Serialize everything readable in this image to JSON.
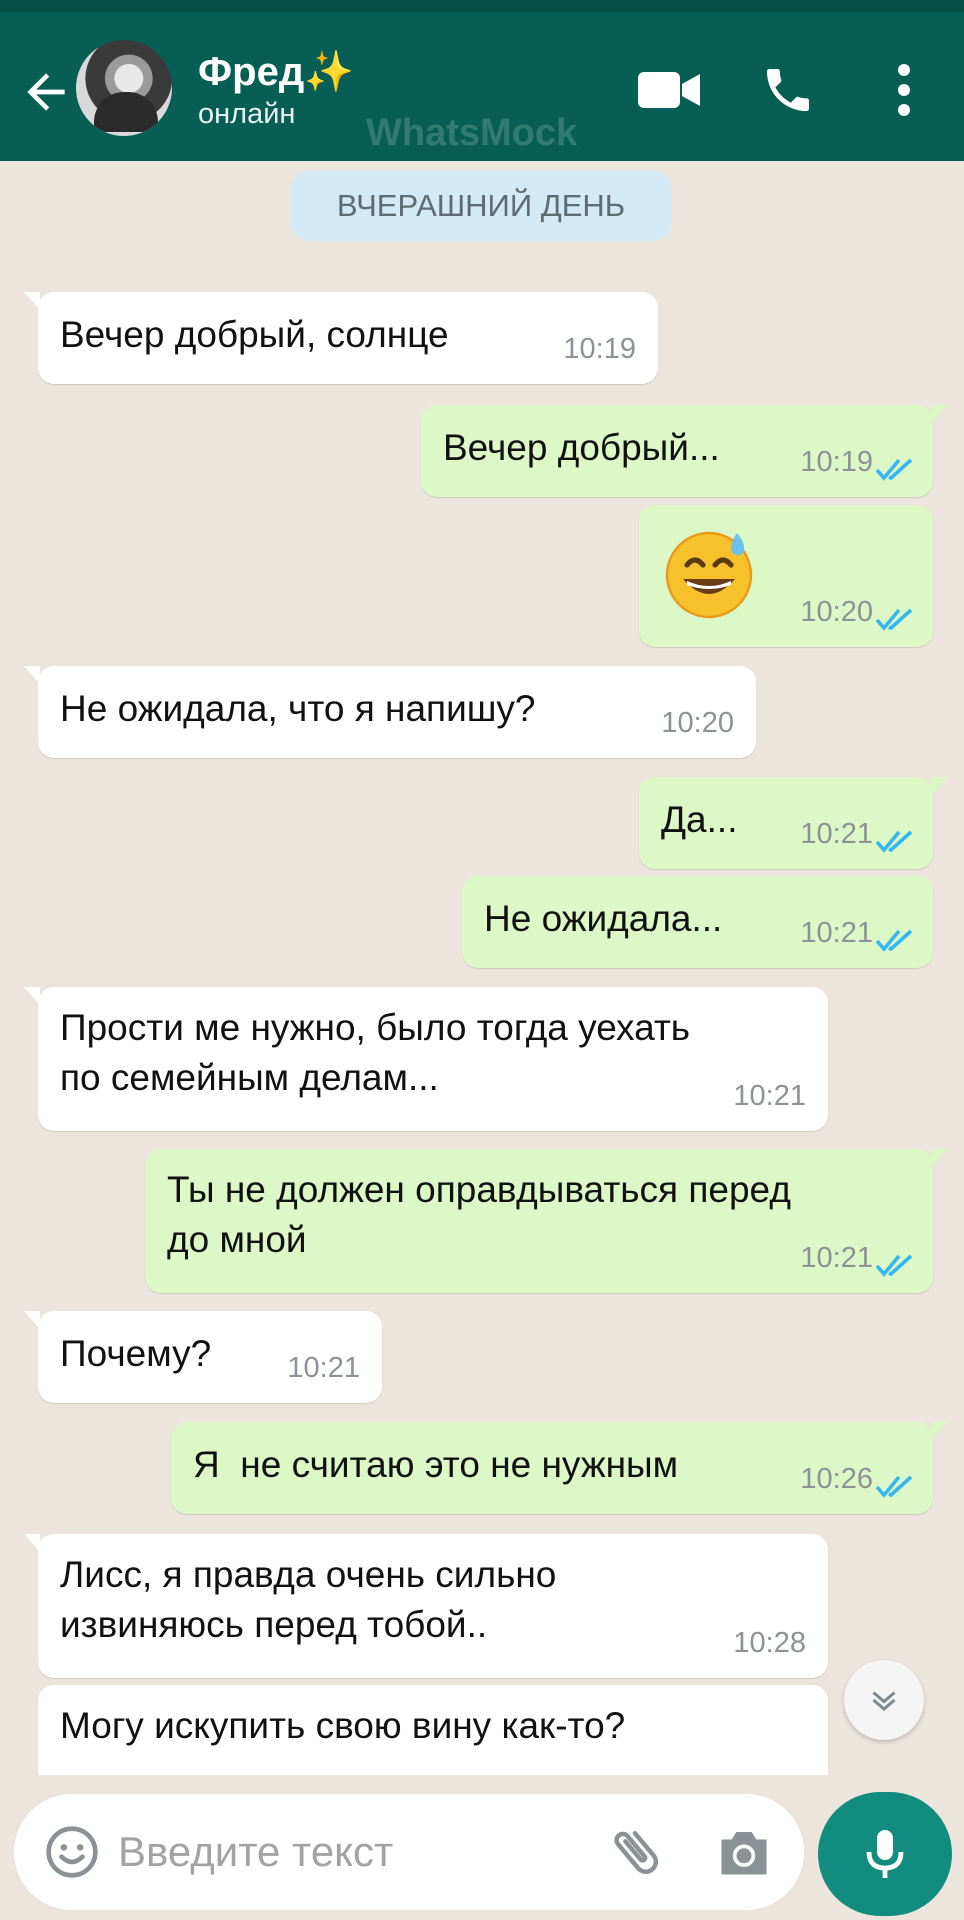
{
  "colors": {
    "header": "#075e54",
    "incoming_bubble": "#ffffff",
    "outgoing_bubble": "#dcf8c6",
    "read_ticks": "#34b7f1",
    "mic_button": "#128c7e",
    "background": "#ece5dd"
  },
  "header": {
    "contact_name": "Фред✨",
    "status": "онлайн",
    "watermark": "WhatsMock",
    "icons": [
      "back-arrow-icon",
      "video-call-icon",
      "phone-call-icon",
      "more-vert-icon"
    ]
  },
  "chat": {
    "date_chip": "ВЧЕРАШНИЙ ДЕНЬ",
    "messages": [
      {
        "direction": "in",
        "text": "Вечер добрый, солнце",
        "time": "10:19"
      },
      {
        "direction": "out",
        "text": "Вечер добрый...",
        "time": "10:19",
        "status": "read"
      },
      {
        "direction": "out",
        "emoji": "smiling-face-with-sweat-icon",
        "time": "10:20",
        "status": "read"
      },
      {
        "direction": "in",
        "text": "Не ожидала, что я напишу?",
        "time": "10:20"
      },
      {
        "direction": "out",
        "text": "Да...",
        "time": "10:21",
        "status": "read"
      },
      {
        "direction": "out",
        "text": "Не ожидала...",
        "time": "10:21",
        "status": "read"
      },
      {
        "direction": "in",
        "lines": [
          "Прости ме нужно, было тогда уехать",
          "по семейным делам..."
        ],
        "time": "10:21"
      },
      {
        "direction": "out",
        "lines": [
          "Ты не должен оправдываться перед",
          "до мной"
        ],
        "time": "10:21",
        "status": "read"
      },
      {
        "direction": "in",
        "text": "Почему?",
        "time": "10:21"
      },
      {
        "direction": "out",
        "text": "Я  не считаю это не нужным",
        "time": "10:26",
        "status": "read"
      },
      {
        "direction": "in",
        "lines": [
          "Лисс, я правда очень сильно",
          "извиняюсь перед тобой.."
        ],
        "time": "10:28"
      },
      {
        "direction": "in",
        "text": "Могу искупить свою вину как-то?"
      }
    ]
  },
  "input": {
    "placeholder": "Введите текст",
    "icons": [
      "emoji-icon",
      "attach-icon",
      "camera-icon",
      "mic-icon"
    ]
  }
}
